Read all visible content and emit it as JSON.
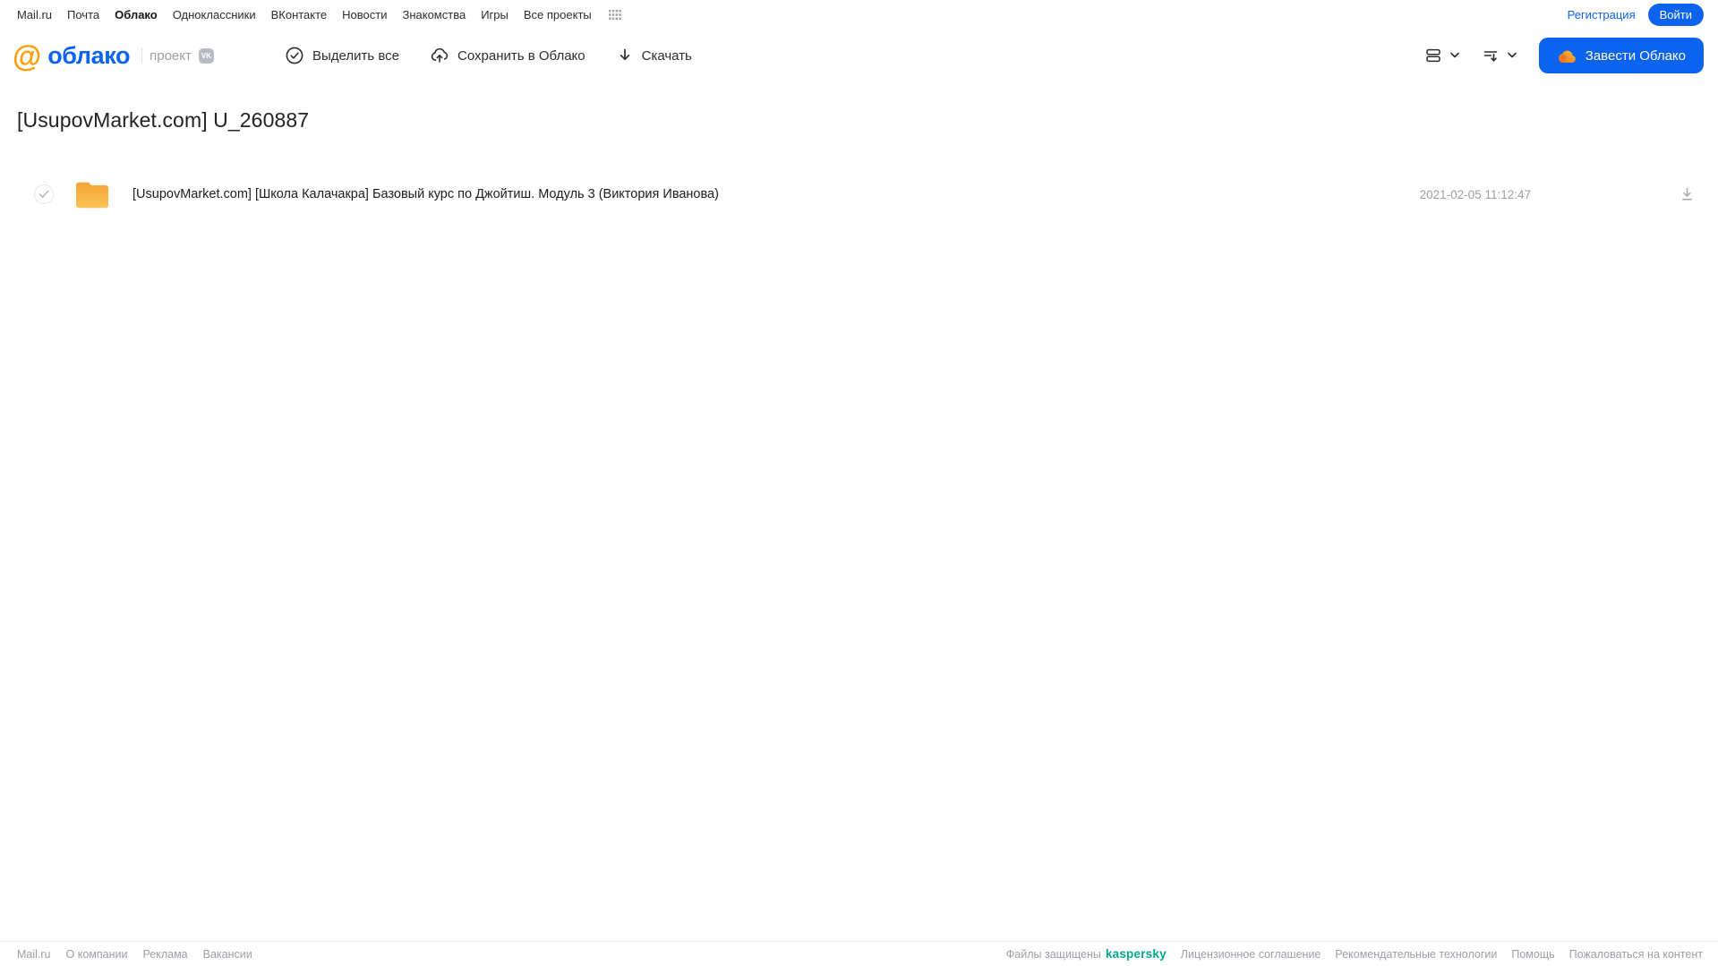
{
  "top_nav": {
    "items": [
      "Mail.ru",
      "Почта",
      "Облако",
      "Одноклассники",
      "ВКонтакте",
      "Новости",
      "Знакомства",
      "Игры",
      "Все проекты"
    ],
    "active_item": "Облако",
    "register_label": "Регистрация",
    "login_label": "Войти"
  },
  "header": {
    "logo_at": "@",
    "logo_text": "облако",
    "project_label": "проект",
    "vk_badge": "VK",
    "toolbar": {
      "select_all_label": "Выделить все",
      "save_to_cloud_label": "Сохранить в Облако",
      "download_label": "Скачать"
    },
    "get_cloud_button_label": "Завести Облако"
  },
  "main": {
    "title": "[UsupovMarket.com] U_260887",
    "files": [
      {
        "type": "folder",
        "name": "[UsupovMarket.com] [Школа Калачакра] Базовый курс по Джойтиш. Модуль 3 (Виктория Иванова)",
        "date": "2021-02-05 11:12:47"
      }
    ]
  },
  "footer": {
    "left_links": [
      "Mail.ru",
      "О компании",
      "Реклама",
      "Вакансии"
    ],
    "protected_by_label": "Файлы защищены",
    "kaspersky_label": "kaspersky",
    "right_links": [
      "Лицензионное соглашение",
      "Рекомендательные технологии",
      "Помощь",
      "Пожаловаться на контент"
    ]
  },
  "colors": {
    "accent_blue": "#0b63f0",
    "logo_orange": "#ff9e00",
    "folder_yellow": "#f9b341",
    "kaspersky_green": "#00a88e",
    "muted_gray": "#9b9fa5"
  }
}
